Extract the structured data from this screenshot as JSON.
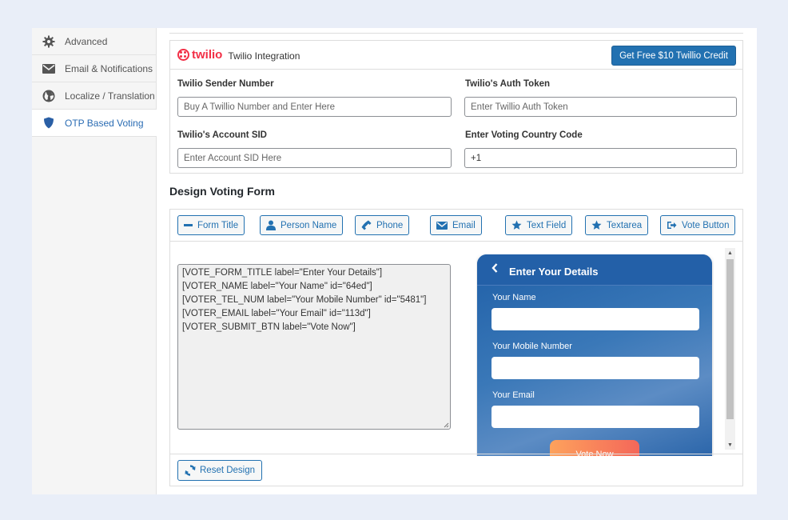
{
  "sidebar": {
    "items": [
      {
        "label": "Advanced",
        "icon": "gear-icon",
        "active": false
      },
      {
        "label": "Email & Notifications",
        "icon": "envelope-icon",
        "active": false
      },
      {
        "label": "Localize / Translation",
        "icon": "globe-icon",
        "active": false
      },
      {
        "label": "OTP Based Voting",
        "icon": "shield-icon",
        "active": true
      }
    ]
  },
  "twilio": {
    "logo_text": "twilio",
    "title": "Twilio Integration",
    "credit_button": "Get Free $10 Twillio Credit",
    "fields": {
      "sender_number": {
        "label": "Twilio Sender Number",
        "placeholder": "Buy A Twillio Number and Enter Here",
        "value": ""
      },
      "auth_token": {
        "label": "Twilio's Auth Token",
        "placeholder": "Enter Twillio Auth Token",
        "value": ""
      },
      "account_sid": {
        "label": "Twilio's Account SID",
        "placeholder": "Enter Account SID Here",
        "value": ""
      },
      "country_code": {
        "label": "Enter Voting Country Code",
        "placeholder": "",
        "value": "+1"
      }
    }
  },
  "design": {
    "title": "Design Voting Form",
    "toolbar": [
      {
        "label": "Form Title",
        "icon": "minus-icon"
      },
      {
        "label": "Person Name",
        "icon": "user-icon"
      },
      {
        "label": "Phone",
        "icon": "phone-icon"
      },
      {
        "label": "Email",
        "icon": "envelope-icon"
      },
      {
        "label": "Text Field",
        "icon": "star-icon"
      },
      {
        "label": "Textarea",
        "icon": "star-icon"
      },
      {
        "label": "Vote Button",
        "icon": "sign-out-icon"
      }
    ],
    "code": "[VOTE_FORM_TITLE label=\"Enter Your Details\"]\n[VOTER_NAME label=\"Your Name\" id=\"64ed\"]\n[VOTER_TEL_NUM label=\"Your Mobile Number\" id=\"5481\"]\n[VOTER_EMAIL label=\"Your Email\" id=\"113d\"]\n[VOTER_SUBMIT_BTN label=\"Vote Now\"]",
    "preview": {
      "title": "Enter Your Details",
      "fields": [
        "Your Name",
        "Your Mobile Number",
        "Your Email"
      ],
      "button": "Vote Now"
    },
    "reset_button": "Reset Design"
  },
  "colors": {
    "primary": "#2271b1",
    "twilio_red": "#f22f46",
    "active_sidebar": "#2a6cb3",
    "preview_blue": "#2360a8"
  }
}
